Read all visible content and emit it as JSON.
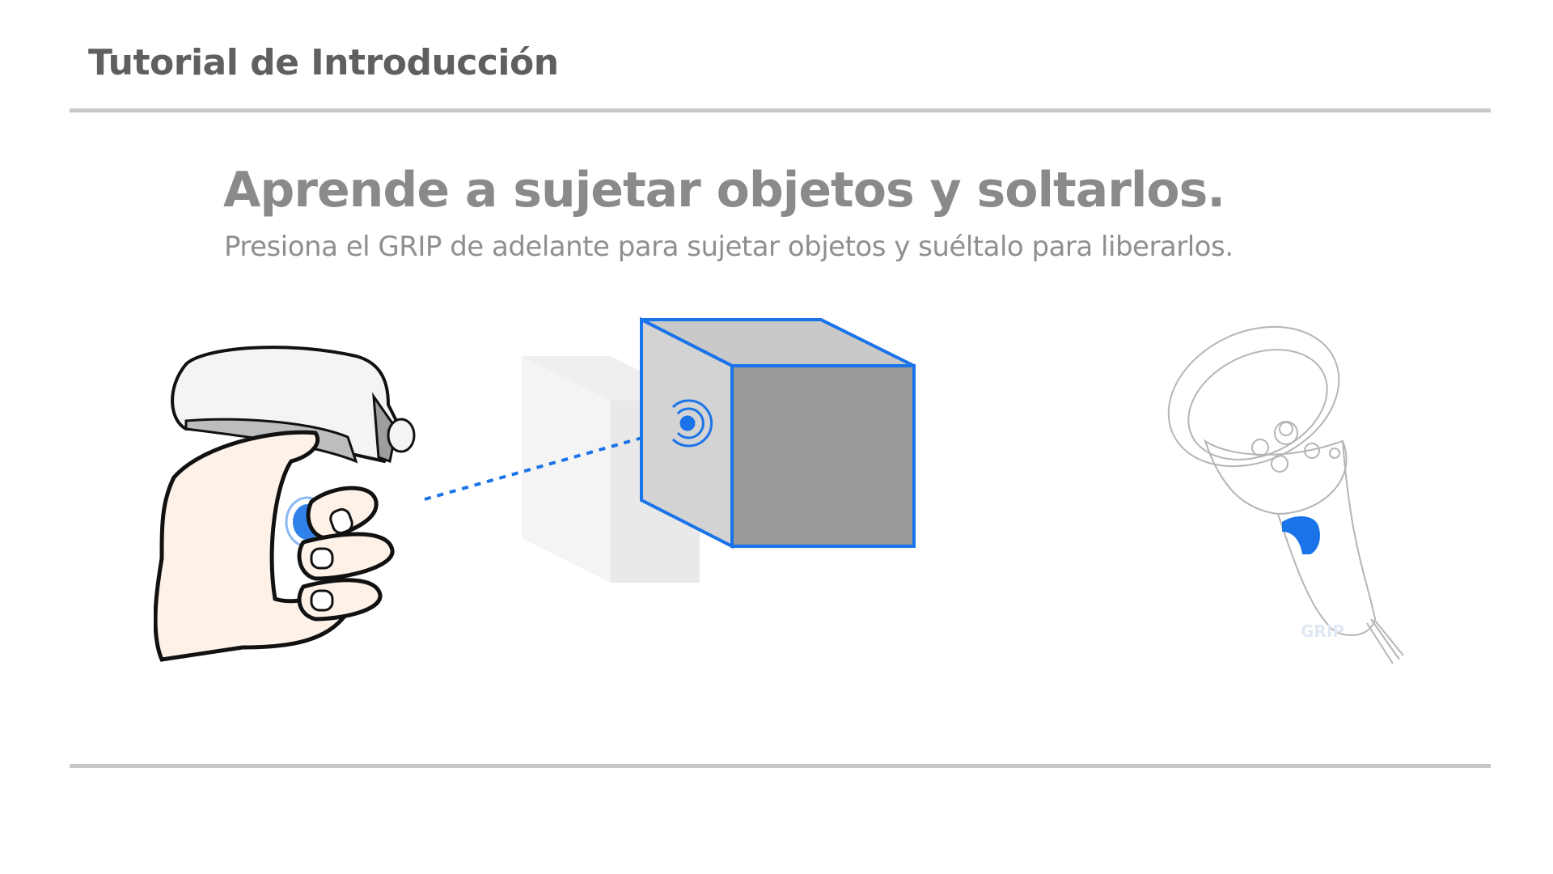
{
  "header": {
    "title": "Tutorial de Introducción"
  },
  "lesson": {
    "title": "Aprende a sujetar objetos y soltarlos.",
    "subtitle": "Presiona el GRIP de adelante para sujetar objetos y suéltalo para liberarlos."
  },
  "controller": {
    "grip_label": "GRIP"
  },
  "icons": [
    "hand-controller-icon",
    "grab-target-icon",
    "cube-icon",
    "vr-controller-icon",
    "grip-button-icon"
  ],
  "colors": {
    "accent": "#1a73e8",
    "text": "#5f5f5f",
    "rule": "#c8c8c8"
  }
}
